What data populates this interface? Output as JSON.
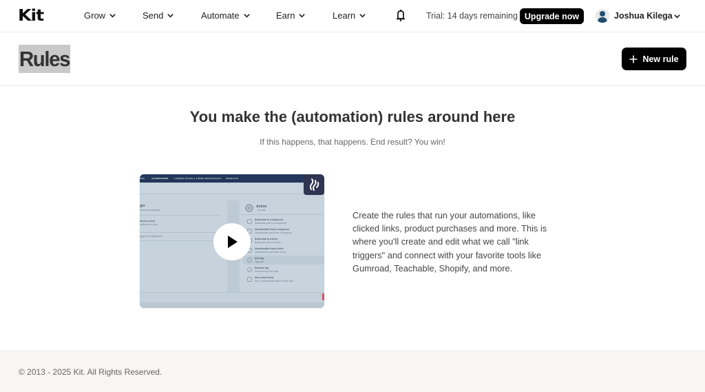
{
  "app": {
    "logo_text": "Kit"
  },
  "nav": {
    "items": [
      {
        "label": "Grow"
      },
      {
        "label": "Send"
      },
      {
        "label": "Automate"
      },
      {
        "label": "Earn"
      },
      {
        "label": "Learn"
      }
    ],
    "notifications_icon": "bell-icon",
    "trial_text": "Trial: 14 days remaining",
    "upgrade_label": "Upgrade now",
    "user": {
      "name": "Joshua Kilega",
      "avatar_icon": "user-silhouette-icon",
      "avatar_color": "#1f4e73"
    }
  },
  "header": {
    "title": "Rules",
    "new_rule_label": "New rule",
    "new_rule_icon": "plus-icon"
  },
  "main": {
    "title": "You make the (automation) rules around here",
    "subtitle": "If this happens, that happens. End result? You win!",
    "video": {
      "play_icon": "play-icon",
      "thumbnail": {
        "nav_tabs": [
          "ERS",
          "AUTOMATIONS",
          "LANDING PAGES & FORMS",
          "BROADCASTS",
          "PRODUCTS"
        ],
        "trigger_heading": "ger",
        "trigger_sub": "this event happens...",
        "trigger_item": "bes to a form",
        "trigger_item_sub": "scribes to a form",
        "trigger_value": "graphy for Beginners",
        "action_heading": "Action",
        "action_sub": "...do this.",
        "actions": [
          {
            "title": "Subscribe to a sequence",
            "sub": "Subscribe user to a sequence"
          },
          {
            "title": "Unsubscribe from a sequence",
            "sub": "Unsubscribe user from a sequence"
          },
          {
            "title": "Subscribe to a form",
            "sub": "Subscribe user to a form"
          },
          {
            "title": "Unsubscribe from a form",
            "sub": "Unsubscribe user from a form"
          },
          {
            "title": "Add tag",
            "sub": "Tag user"
          },
          {
            "title": "Remove tag",
            "sub": "Remove tag from user"
          },
          {
            "title": "Set custom field",
            "sub": "Set a custom field value for this user"
          }
        ]
      }
    },
    "description": "Create the rules that run your automations, like clicked links, product purchases and more. This is where you'll create and edit what we call \"link triggers\" and connect with your favorite tools like Gumroad, Teachable, Shopify, and more."
  },
  "footer": {
    "copyright": "© 2013 - 2025 Kit. All Rights Reserved."
  }
}
